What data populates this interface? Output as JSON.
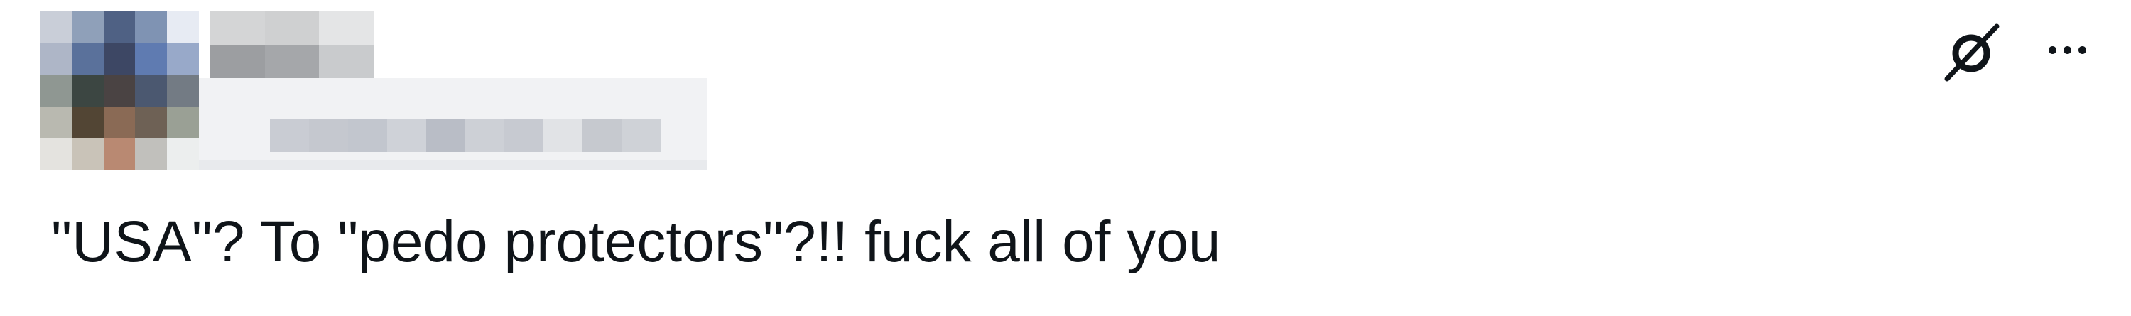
{
  "post": {
    "text": "\"USA\"? To \"pedo protectors\"?!! fuck all of you",
    "author": {
      "avatar_icon": "pixelated-avatar",
      "name_icon": "redacted-display-name",
      "handle_icon": "redacted-username"
    },
    "actions": {
      "grok_icon": "grok-icon",
      "more_icon": "more-options-icon"
    }
  },
  "colors": {
    "text": "#0f1419",
    "background": "#ffffff",
    "redaction": "#f1f2f4"
  }
}
